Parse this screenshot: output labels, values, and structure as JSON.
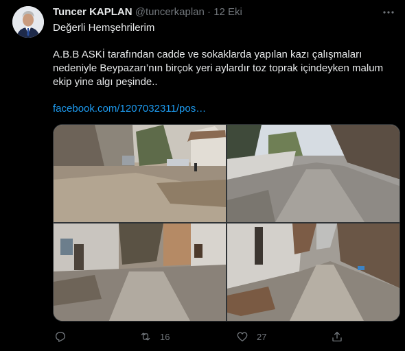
{
  "tweet": {
    "author_name": "Tuncer KAPLAN",
    "handle": "@tuncerkaplan",
    "separator": "·",
    "date": "12 Eki",
    "line1": "Değerli Hemşehrilerim",
    "body": "A.B.B ASKİ tarafından cadde ve sokaklarda yapılan kazı çalışmaları nedeniyle Beypazarı’nın birçok yeri aylardır toz toprak içindeyken malum ekip yine algı peşinde..",
    "link": "facebook.com/1207032311/pos…",
    "retweets": "16",
    "likes": "27"
  },
  "icons": {
    "more": "more-dots-icon",
    "reply": "reply-icon",
    "retweet": "retweet-icon",
    "like": "heart-icon",
    "share": "share-icon"
  },
  "colors": {
    "background": "#000000",
    "text": "#e7e9ea",
    "muted": "#71767b",
    "link": "#1d9bf0"
  }
}
